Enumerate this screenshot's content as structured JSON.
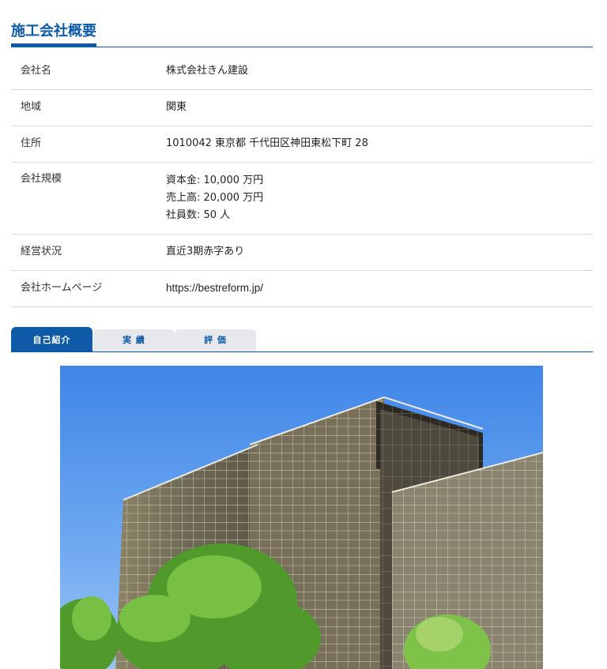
{
  "section": {
    "title": "施工会社概要"
  },
  "company": {
    "rows": [
      {
        "label": "会社名",
        "value": "株式会社きん建設"
      },
      {
        "label": "地域",
        "value": "関東"
      },
      {
        "label": "住所",
        "value": "1010042 東京都 千代田区神田東松下町 28"
      },
      {
        "label": "会社規模",
        "lines": [
          "資本金: 10,000 万円",
          "売上高: 20,000 万円",
          "社員数: 50 人"
        ]
      },
      {
        "label": "経営状況",
        "value": "直近3期赤字あり"
      },
      {
        "label": "会社ホームページ",
        "value": "https://bestreform.jp/"
      }
    ]
  },
  "tabs": [
    {
      "label": "自己紹介",
      "active": true
    },
    {
      "label": "実 績",
      "active": false
    },
    {
      "label": "評 価",
      "active": false
    }
  ],
  "colors": {
    "accent": "#0e5aa7",
    "tab_inactive_bg": "#e6e8ec",
    "row_border": "#d9d9d9"
  }
}
